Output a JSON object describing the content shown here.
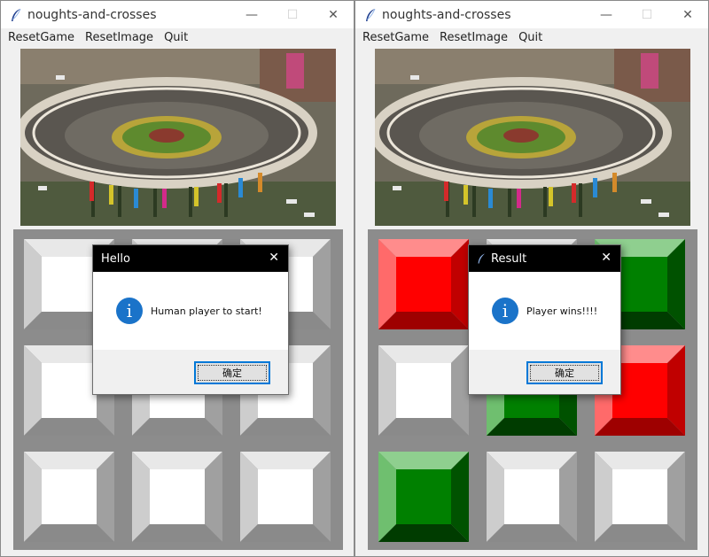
{
  "colors": {
    "board_bg": "#8c8c8c",
    "red": "#ff0000",
    "green": "#008000",
    "info_blue": "#1a73c9",
    "button_focus": "#0078d7"
  },
  "windows": [
    {
      "title": "noughts-and-crosses",
      "controls": {
        "minimize": "—",
        "maximize": "☐",
        "close": "✕"
      },
      "menu": [
        "ResetGame",
        "ResetImage",
        "Quit"
      ],
      "board": [
        "empty",
        "empty",
        "empty",
        "empty",
        "empty",
        "empty",
        "empty",
        "empty",
        "empty"
      ],
      "dialog": {
        "title": "Hello",
        "has_icon": false,
        "close": "✕",
        "icon": "i",
        "message": "Human player to start!",
        "ok_label": "确定"
      }
    },
    {
      "title": "noughts-and-crosses",
      "controls": {
        "minimize": "—",
        "maximize": "☐",
        "close": "✕"
      },
      "menu": [
        "ResetGame",
        "ResetImage",
        "Quit"
      ],
      "board": [
        "red",
        "empty",
        "green",
        "empty",
        "green",
        "red",
        "green",
        "empty",
        "empty"
      ],
      "dialog": {
        "title": "Result",
        "has_icon": true,
        "close": "✕",
        "icon": "i",
        "message": "Player wins!!!!",
        "ok_label": "确定"
      }
    }
  ]
}
